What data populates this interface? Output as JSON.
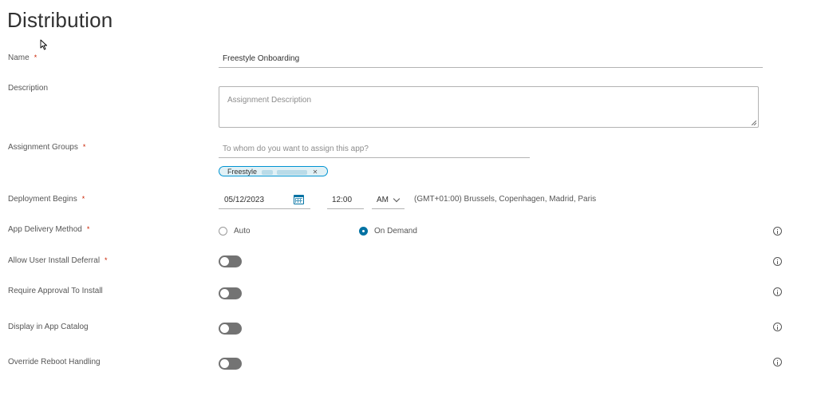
{
  "page": {
    "title": "Distribution"
  },
  "form": {
    "name": {
      "label": "Name",
      "required": "*",
      "value": "Freestyle Onboarding"
    },
    "description": {
      "label": "Description",
      "placeholder": "Assignment Description"
    },
    "assignment_groups": {
      "label": "Assignment Groups",
      "required": "*",
      "placeholder": "To whom do you want to assign this app?",
      "chip_label": "Freestyle",
      "chip_remove": "✕"
    },
    "deployment_begins": {
      "label": "Deployment Begins",
      "required": "*",
      "date": "05/12/2023",
      "time": "12:00",
      "ampm": "AM",
      "timezone": "(GMT+01:00) Brussels, Copenhagen, Madrid, Paris"
    },
    "app_delivery_method": {
      "label": "App Delivery Method",
      "required": "*",
      "options": [
        {
          "label": "Auto",
          "checked": false
        },
        {
          "label": "On Demand",
          "checked": true
        }
      ]
    },
    "allow_user_install_deferral": {
      "label": "Allow User Install Deferral",
      "required": "*",
      "on": false
    },
    "require_approval": {
      "label": "Require Approval To Install",
      "on": false
    },
    "display_in_catalog": {
      "label": "Display in App Catalog",
      "on": false
    },
    "override_reboot": {
      "label": "Override Reboot Handling",
      "on": false
    }
  },
  "colors": {
    "accent": "#0072a3",
    "required": "#c92100",
    "chip_border": "#0094d2",
    "chip_bg": "#e1f1f6",
    "toggle_off": "#737373"
  },
  "icons": {
    "calendar": "calendar-icon",
    "info": "info-icon",
    "chevron": "chevron-down-icon",
    "cursor": "mouse-cursor-icon"
  }
}
